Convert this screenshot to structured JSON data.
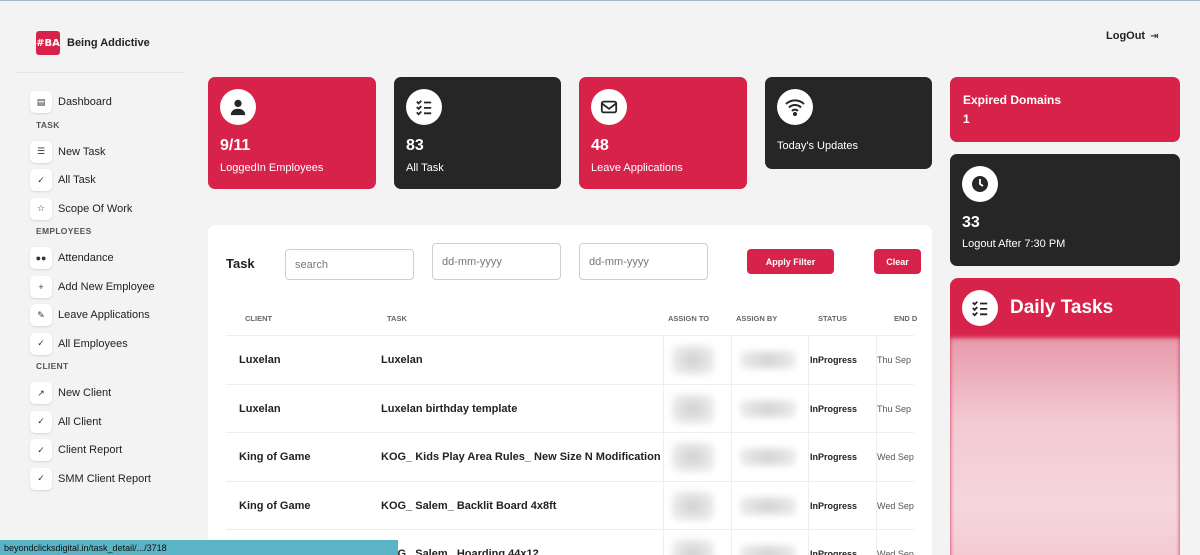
{
  "brand": {
    "logo": "#BA",
    "name": "Being Addictive"
  },
  "header": {
    "logout_label": "LogOut",
    "logout_icon": "logout-icon"
  },
  "sidebar": {
    "dashboard": "Dashboard",
    "task_section": "TASK",
    "task_items": [
      "New Task",
      "All Task",
      "Scope Of Work"
    ],
    "employees_section": "EMPLOYEES",
    "employee_items": [
      "Attendance",
      "Add New Employee",
      "Leave Applications",
      "All Employees"
    ],
    "client_section": "CLIENT",
    "client_items": [
      "New Client",
      "All Client",
      "Client Report",
      "SMM Client Report"
    ]
  },
  "stats": {
    "logged_in": {
      "value": "9/11",
      "label": "LoggedIn Employees",
      "icon": "user-icon"
    },
    "all_task": {
      "value": "83",
      "label": "All Task",
      "icon": "checklist-icon"
    },
    "leave": {
      "value": "48",
      "label": "Leave Applications",
      "icon": "mail-icon"
    },
    "updates": {
      "label": "Today's Updates",
      "icon": "wifi-icon"
    },
    "expired": {
      "label": "Expired Domains",
      "value": "1"
    },
    "logout_after": {
      "value": "33",
      "label": "Logout After 7:30 PM",
      "icon": "clock-icon"
    }
  },
  "daily_tasks": {
    "title": "Daily Tasks",
    "icon": "checklist-icon"
  },
  "task_panel": {
    "title": "Task",
    "search_placeholder": "search",
    "date_from_placeholder": "dd-mm-yyyy",
    "date_to_placeholder": "dd-mm-yyyy",
    "apply_label": "Apply Filter",
    "clear_label": "Clear",
    "columns": [
      "CLIENT",
      "TASK",
      "ASSIGN TO",
      "ASSIGN BY",
      "STATUS",
      "END D"
    ],
    "rows": [
      {
        "client": "Luxelan",
        "task": "Luxelan",
        "status": "InProgress",
        "end": "Thu Sep"
      },
      {
        "client": "Luxelan",
        "task": "Luxelan birthday template",
        "status": "InProgress",
        "end": "Thu Sep"
      },
      {
        "client": "King of Game",
        "task": "KOG_ Kids Play Area Rules_ New Size N Modification",
        "status": "InProgress",
        "end": "Wed Sep"
      },
      {
        "client": "King of Game",
        "task": "KOG_ Salem_ Backlit Board 4x8ft",
        "status": "InProgress",
        "end": "Wed Sep"
      },
      {
        "client": "",
        "task": "KOG_ Salem_ Hoarding 44x12",
        "status": "InProgress",
        "end": "Wed Sep"
      }
    ]
  },
  "status_url": "beyondclicksdigital.in/task_detail/.../3718",
  "colors": {
    "accent": "#d7234a",
    "dark": "#262626",
    "background": "#f3f3f3"
  }
}
